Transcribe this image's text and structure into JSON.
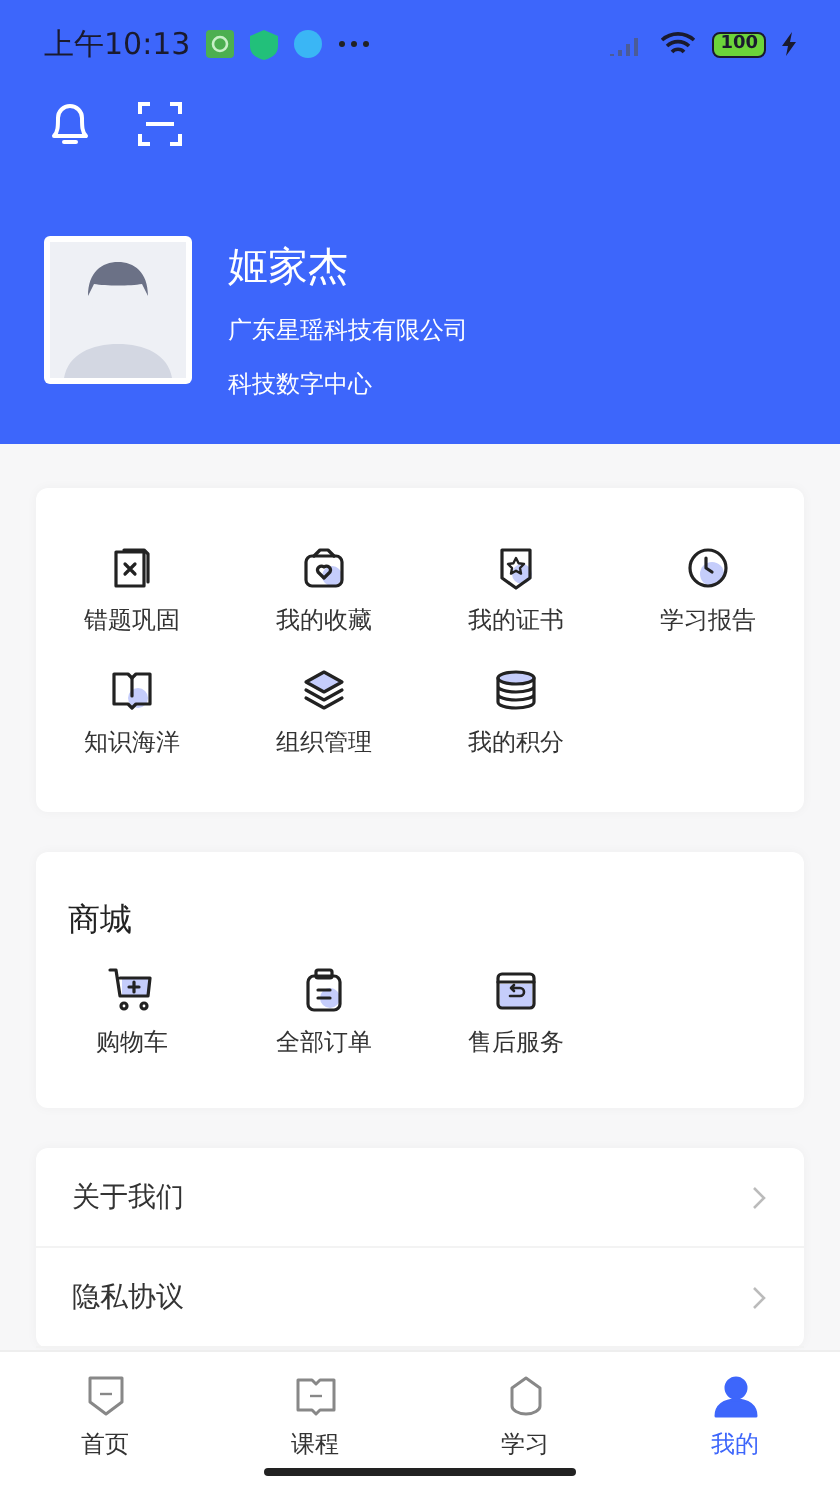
{
  "status_bar": {
    "time": "上午10:13",
    "battery": "100"
  },
  "profile": {
    "name": "姬家杰",
    "company": "广东星瑶科技有限公司",
    "department": "科技数字中心"
  },
  "features": [
    {
      "label": "错题巩固",
      "kind": "mistakes"
    },
    {
      "label": "我的收藏",
      "kind": "favorites"
    },
    {
      "label": "我的证书",
      "kind": "certificate"
    },
    {
      "label": "学习报告",
      "kind": "report"
    },
    {
      "label": "知识海洋",
      "kind": "knowledge"
    },
    {
      "label": "组织管理",
      "kind": "organization"
    },
    {
      "label": "我的积分",
      "kind": "points"
    }
  ],
  "shop": {
    "title": "商城",
    "items": [
      {
        "label": "购物车",
        "kind": "cart"
      },
      {
        "label": "全部订单",
        "kind": "orders"
      },
      {
        "label": "售后服务",
        "kind": "service"
      }
    ]
  },
  "menu": [
    {
      "label": "关于我们"
    },
    {
      "label": "隐私协议"
    }
  ],
  "tab_bar": [
    {
      "label": "首页",
      "kind": "home",
      "selected": false
    },
    {
      "label": "课程",
      "kind": "course",
      "selected": false
    },
    {
      "label": "学习",
      "kind": "study",
      "selected": false
    },
    {
      "label": "我的",
      "kind": "mine",
      "selected": true
    }
  ]
}
